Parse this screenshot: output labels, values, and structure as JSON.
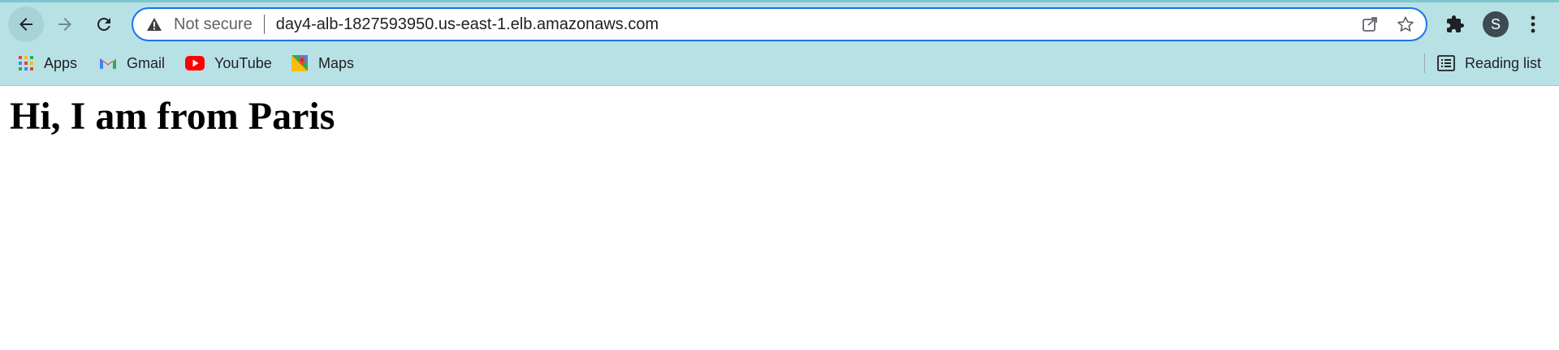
{
  "browser": {
    "security_label": "Not secure",
    "url": "day4-alb-1827593950.us-east-1.elb.amazonaws.com",
    "profile_initial": "S",
    "theme_color": "#b8e1e6",
    "accent_color": "#1a73e8"
  },
  "toolbar": {
    "back_icon": "arrow-left-icon",
    "forward_icon": "arrow-right-icon",
    "reload_icon": "reload-icon",
    "share_icon": "share-icon",
    "bookmark_icon": "star-icon",
    "extensions_icon": "puzzle-icon",
    "menu_icon": "kebab-menu-icon"
  },
  "bookmarks": {
    "items": [
      {
        "label": "Apps",
        "icon": "apps-grid-icon"
      },
      {
        "label": "Gmail",
        "icon": "gmail-icon"
      },
      {
        "label": "YouTube",
        "icon": "youtube-icon"
      },
      {
        "label": "Maps",
        "icon": "maps-icon"
      }
    ],
    "reading_list": {
      "label": "Reading list",
      "icon": "reading-list-icon"
    }
  },
  "page": {
    "heading": "Hi, I am from Paris"
  }
}
